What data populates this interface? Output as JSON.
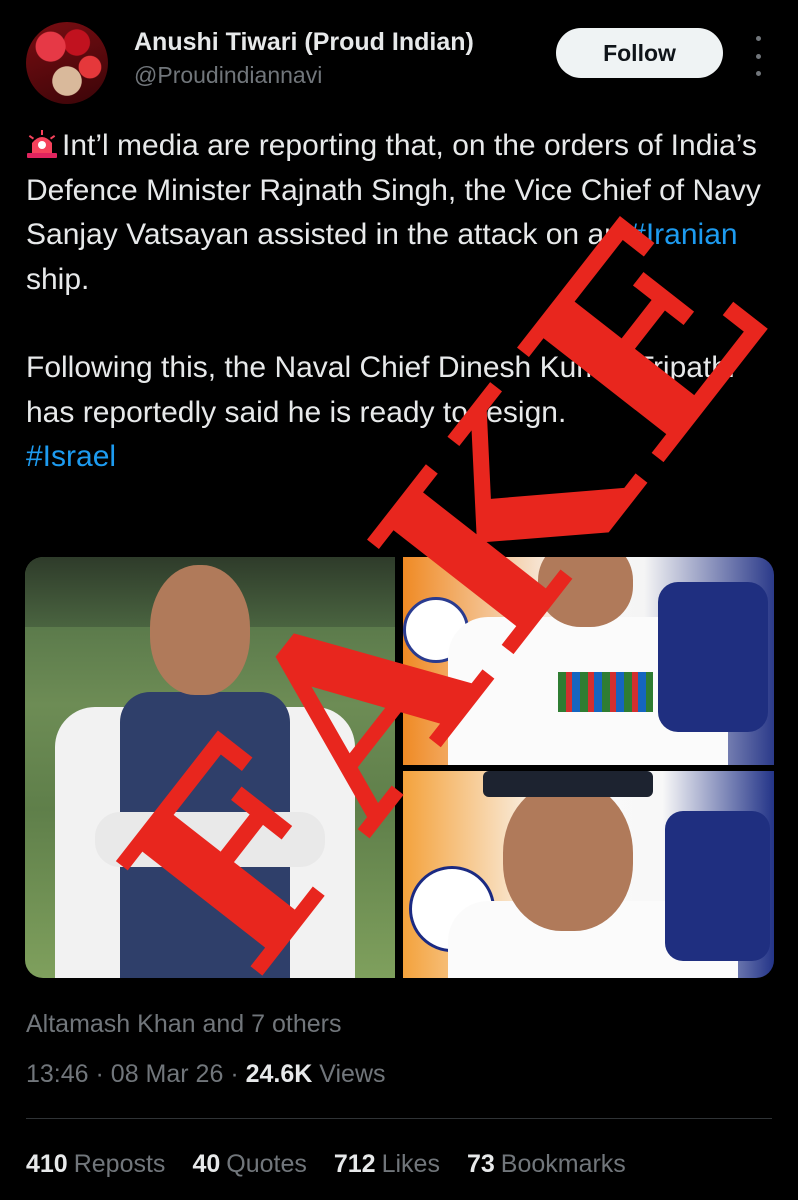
{
  "author": {
    "display_name": "Anushi Tiwari (Proud Indian)",
    "handle": "@Proudindiannavi",
    "follow_label": "Follow"
  },
  "tweet": {
    "paragraph1_pre": "Int’l media are reporting that, on the orders of India’s Defence Minister Rajnath Singh, the Vice Chief of Navy Sanjay Vatsayan assisted in the attack on an ",
    "hashtag_iranian": "#Iranian",
    "paragraph1_post": " ship.",
    "paragraph2": "Following this, the Naval Chief Dinesh Kumar Tripathi has reportedly said he is ready to resign.",
    "hashtag_israel": "#Israel"
  },
  "overlay": {
    "stamp_text": "FAKE",
    "stamp_color": "#e8261e"
  },
  "engagement": {
    "liked_by": "Altamash Khan and 7 others",
    "time": "13:46",
    "date": "08 Mar 26",
    "views_count": "24.6K",
    "views_label": "Views",
    "reposts_count": "410",
    "reposts_label": "Reposts",
    "quotes_count": "40",
    "quotes_label": "Quotes",
    "likes_count": "712",
    "likes_label": "Likes",
    "bookmarks_count": "73",
    "bookmarks_label": "Bookmarks"
  },
  "colors": {
    "background": "#000000",
    "text": "#e7e9ea",
    "muted": "#71767b",
    "link": "#1d9bf0"
  }
}
